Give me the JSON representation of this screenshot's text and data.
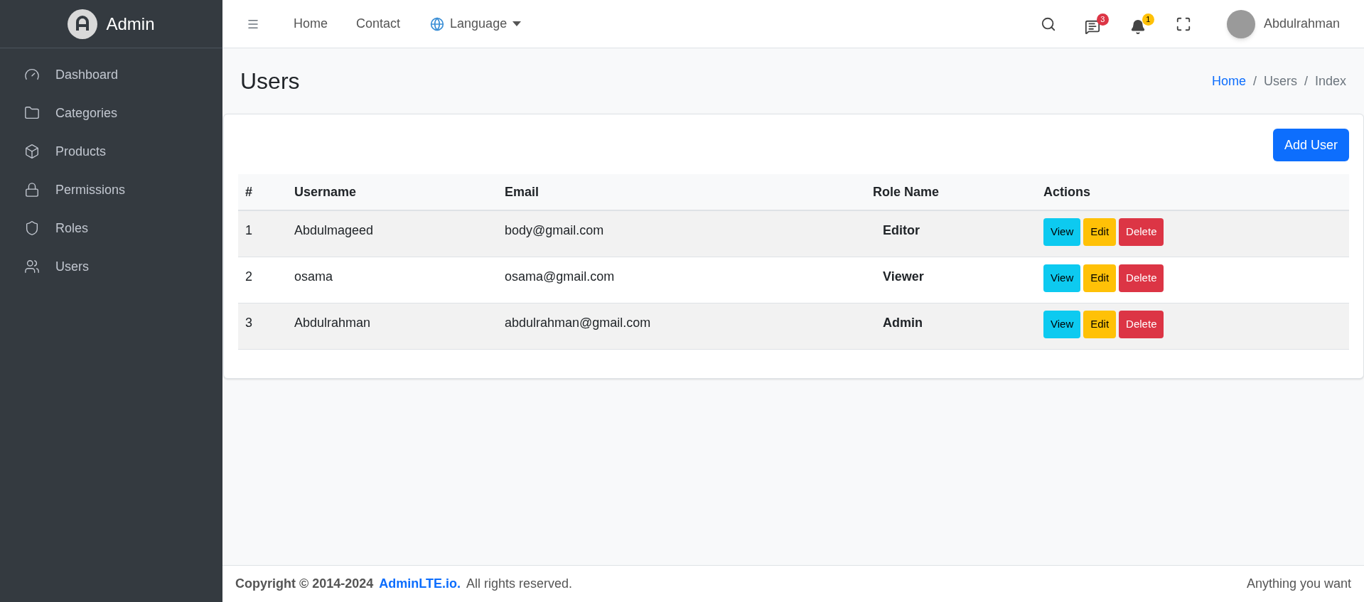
{
  "brand": {
    "name": "Admin"
  },
  "sidebar": {
    "items": [
      {
        "label": "Dashboard"
      },
      {
        "label": "Categories"
      },
      {
        "label": "Products"
      },
      {
        "label": "Permissions"
      },
      {
        "label": "Roles"
      },
      {
        "label": "Users"
      }
    ]
  },
  "navbar": {
    "links": [
      "Home",
      "Contact"
    ],
    "language": "Language",
    "messages_count": "3",
    "notifications_count": "1",
    "user": "Abdulrahman"
  },
  "page": {
    "title": "Users",
    "separators": [
      "/",
      "/"
    ],
    "breadcrumb": [
      {
        "label": "Home",
        "link": true
      },
      {
        "label": "Users",
        "link": false
      },
      {
        "label": "Index",
        "link": false
      }
    ]
  },
  "card": {
    "add_button": "Add User"
  },
  "table": {
    "columns": [
      "#",
      "Username",
      "Email",
      "Role Name",
      "Actions"
    ],
    "rows": [
      {
        "cells": [
          "1",
          "Abdulmageed",
          "body@gmail.com",
          "Editor"
        ],
        "actions": [
          "View",
          "Edit",
          "Delete"
        ]
      },
      {
        "cells": [
          "2",
          "osama",
          "osama@gmail.com",
          "Viewer"
        ],
        "actions": [
          "View",
          "Edit",
          "Delete"
        ]
      },
      {
        "cells": [
          "3",
          "Abdulrahman",
          "abdulrahman@gmail.com",
          "Admin"
        ],
        "actions": [
          "View",
          "Edit",
          "Delete"
        ]
      }
    ]
  },
  "footer": {
    "copyright": "Copyright © 2014-2024",
    "link": "AdminLTE.io.",
    "rights": "All rights reserved.",
    "right_text": "Anything you want"
  }
}
